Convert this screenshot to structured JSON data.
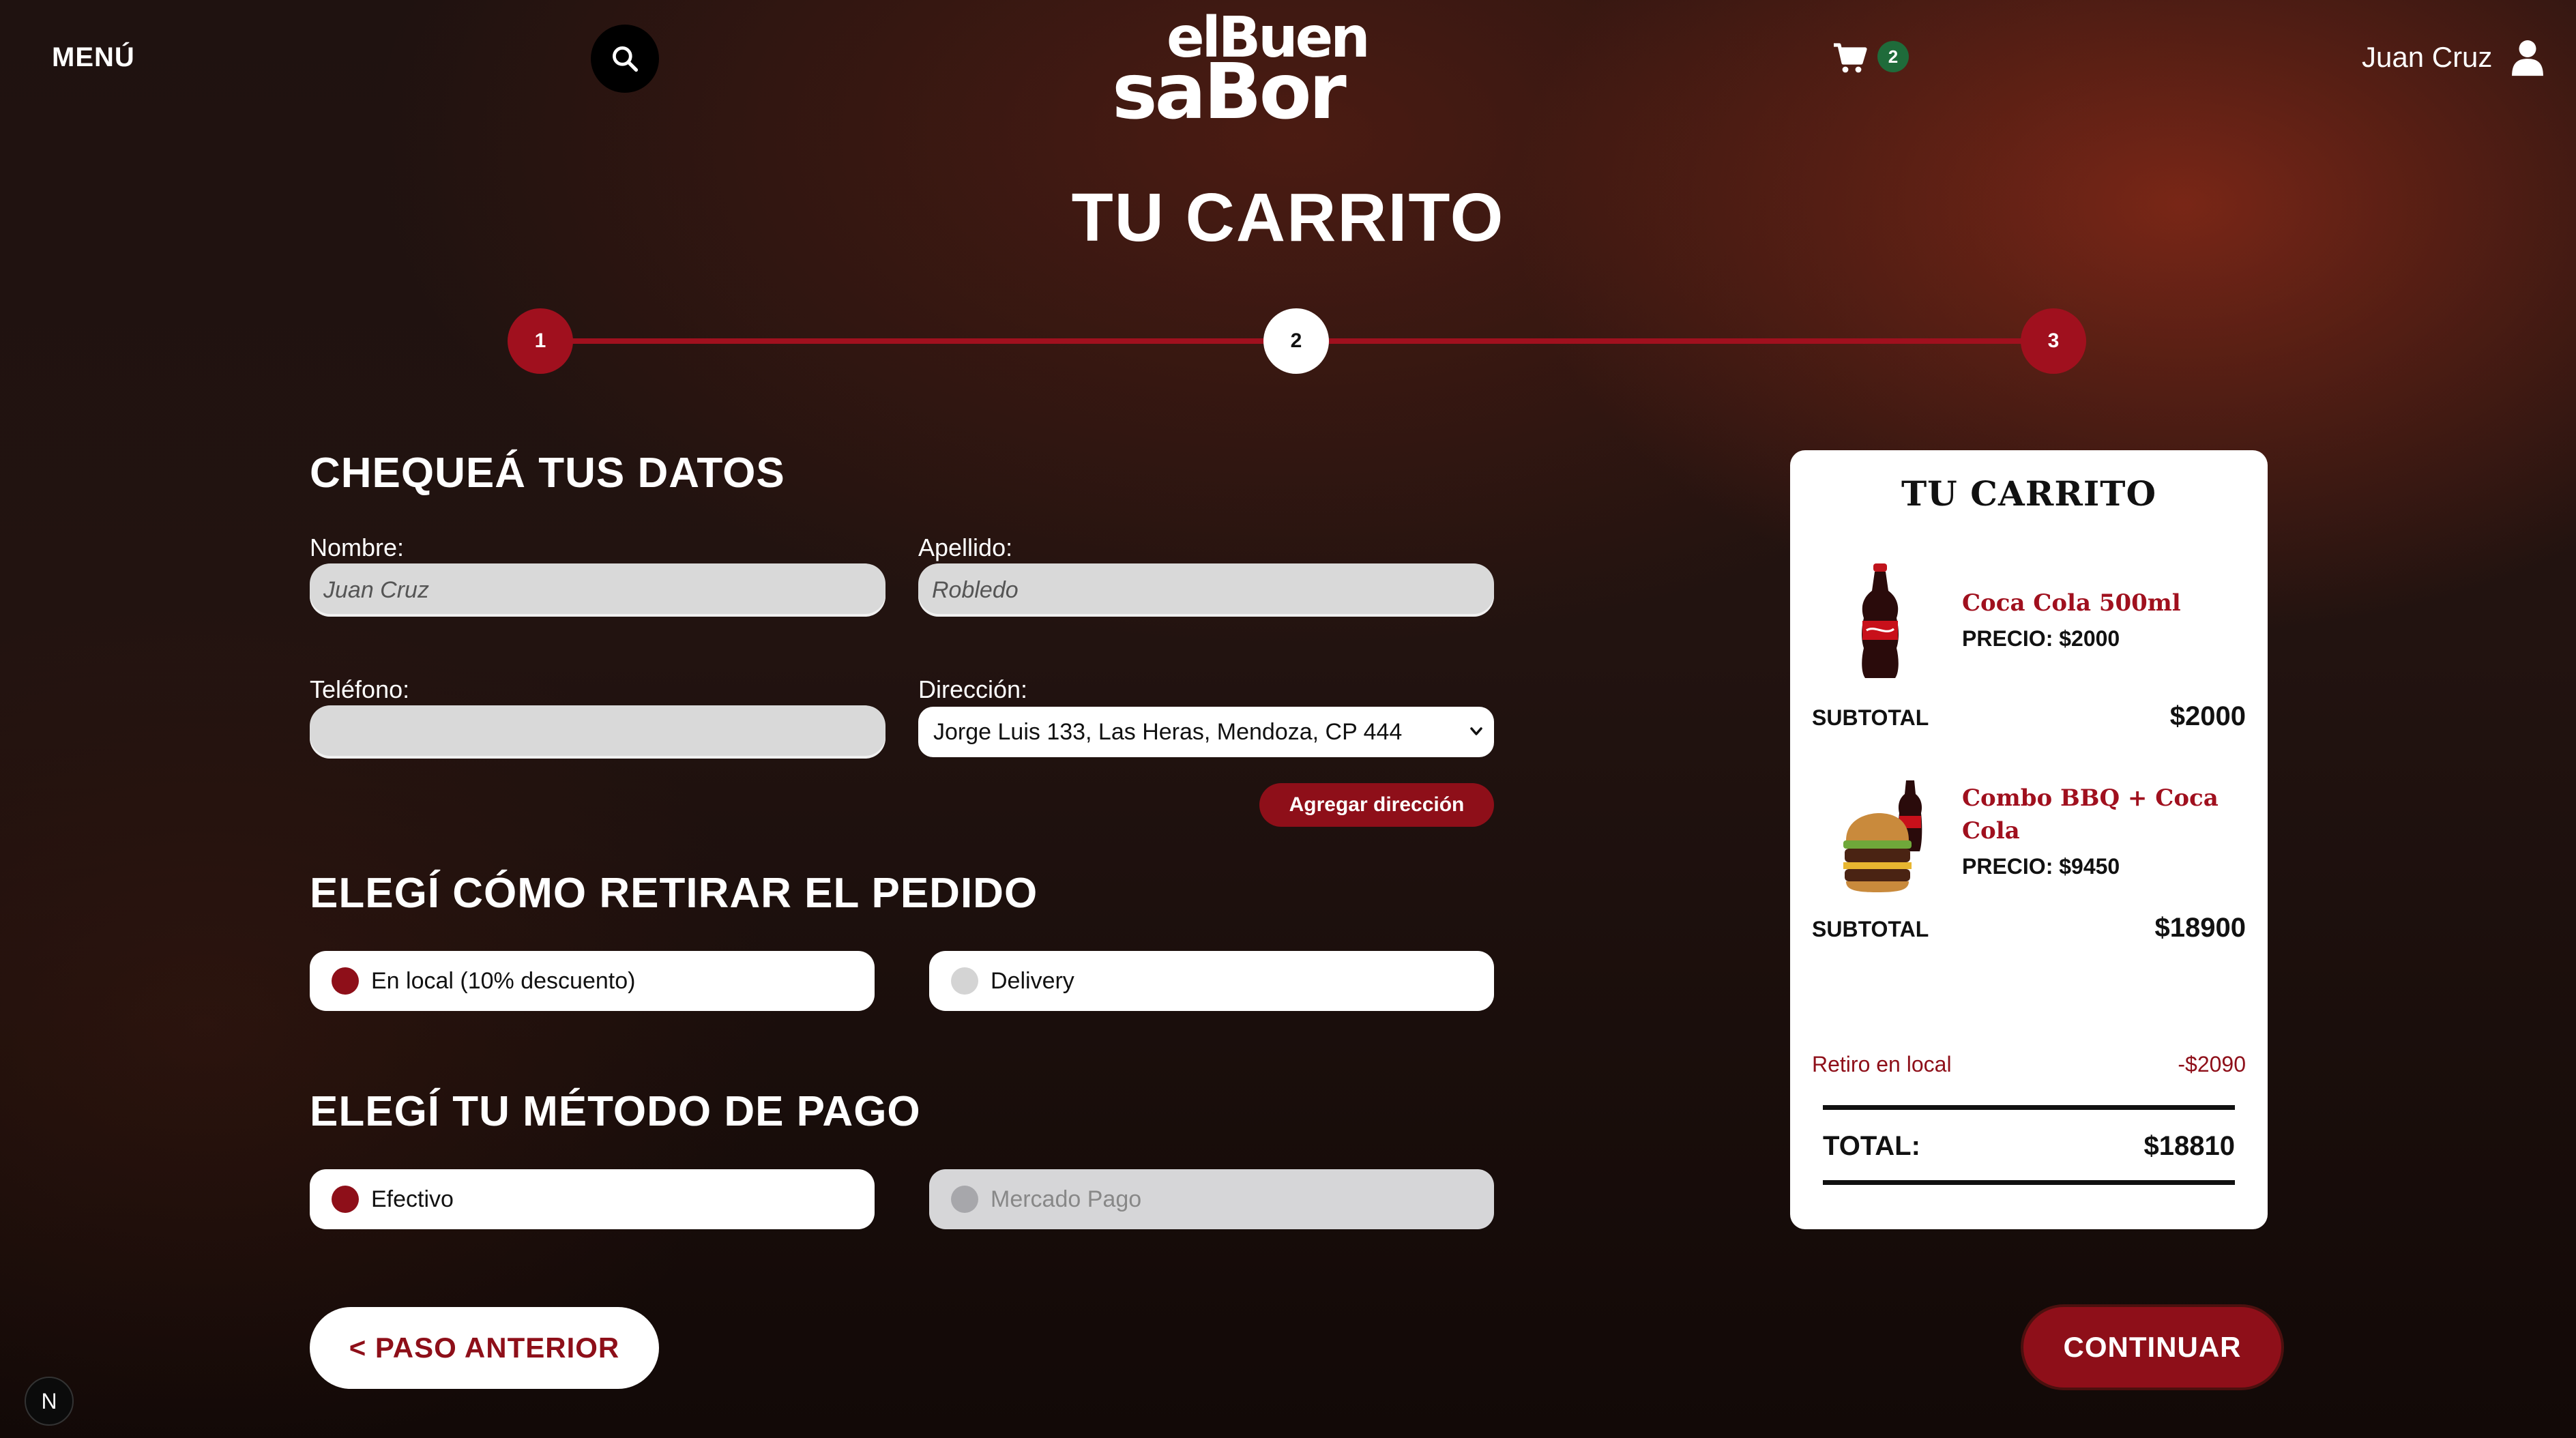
{
  "header": {
    "menu_label": "MENÚ",
    "logo_line1": "elBuen",
    "logo_line2": "saBor",
    "cart_count": "2",
    "user_name": "Juan Cruz"
  },
  "page_title": "TU CARRITO",
  "stepper": {
    "steps": [
      "1",
      "2",
      "3"
    ],
    "current": 2
  },
  "datos": {
    "title": "CHEQUEÁ TUS DATOS",
    "nombre_label": "Nombre:",
    "nombre_value": "Juan Cruz",
    "apellido_label": "Apellido:",
    "apellido_value": "Robledo",
    "telefono_label": "Teléfono:",
    "telefono_value": "",
    "direccion_label": "Dirección:",
    "direccion_value": "Jorge Luis 133, Las Heras, Mendoza, CP 444",
    "add_address_label": "Agregar dirección"
  },
  "retiro": {
    "title": "ELEGÍ CÓMO RETIRAR EL PEDIDO",
    "options": [
      "En local (10% descuento)",
      "Delivery"
    ],
    "selected": 0
  },
  "pago": {
    "title": "ELEGÍ TU MÉTODO DE PAGO",
    "options": [
      "Efectivo",
      "Mercado Pago"
    ],
    "selected": 0
  },
  "buttons": {
    "prev": "< PASO ANTERIOR",
    "next": "CONTINUAR"
  },
  "footer_badge": "N",
  "cart_panel": {
    "title": "TU CARRITO",
    "items": [
      {
        "name": "Coca Cola 500ml",
        "price": "PRECIO: $2000",
        "subtotal_label": "SUBTOTAL",
        "subtotal": "$2000",
        "image": "coca-cola-bottle"
      },
      {
        "name": "Combo BBQ + Coca Cola",
        "price": "PRECIO: $9450",
        "subtotal_label": "SUBTOTAL",
        "subtotal": "$18900",
        "image": "burger-and-coke"
      }
    ],
    "discount_label": "Retiro en local",
    "discount_value": "-$2090",
    "total_label": "TOTAL:",
    "total_value": "$18810"
  },
  "colors": {
    "brand_red": "#8e0f19",
    "step_red": "#a0101e",
    "badge_green": "#1f6b3a"
  }
}
